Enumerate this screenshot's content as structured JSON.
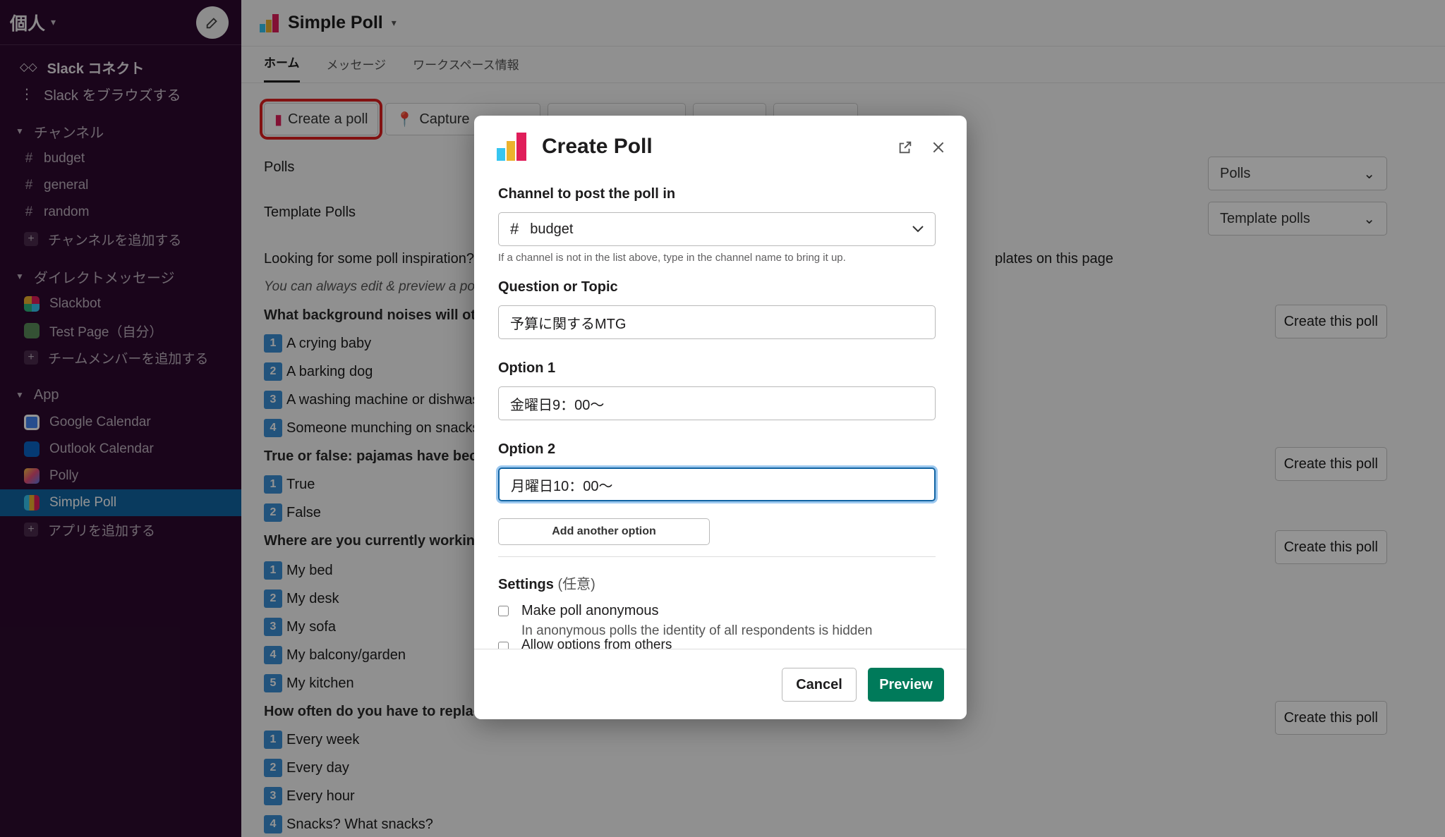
{
  "sidebar": {
    "workspace": "個人",
    "top_items": [
      "Slack コネクト",
      "Slack をブラウズする"
    ],
    "channels_header": "チャンネル",
    "channels": [
      "budget",
      "general",
      "random"
    ],
    "add_channel": "チャンネルを追加する",
    "dm_header": "ダイレクトメッセージ",
    "dms": [
      "Slackbot",
      "Test Page（自分）"
    ],
    "add_member": "チームメンバーを追加する",
    "app_header": "App",
    "apps": [
      "Google Calendar",
      "Outlook Calendar",
      "Polly",
      "Simple Poll"
    ],
    "add_app": "アプリを追加する"
  },
  "main": {
    "title": "Simple Poll",
    "tabs": [
      "ホーム",
      "メッセージ",
      "ワークスペース情報"
    ],
    "buttons": [
      "Create a poll",
      "Capture"
    ],
    "polls_label": "Polls",
    "polls_select": "Polls",
    "template_label": "Template Polls",
    "template_select": "Template polls",
    "inspiration": "Looking for some poll inspiration?",
    "inspiration_tail": "plates on this page",
    "edit_hint": "You can always edit & preview a poll",
    "create_this_poll": "Create this poll",
    "q1": "What background noises will othe",
    "q1_opts": [
      "A crying baby",
      "A barking dog",
      "A washing machine or dishwas",
      "Someone munching on snacks"
    ],
    "q2": "True or false: pajamas have becom",
    "q2_opts": [
      "True",
      "False"
    ],
    "q3": "Where are you currently working",
    "q3_opts": [
      "My bed",
      "My desk",
      "My sofa",
      "My balcony/garden",
      "My kitchen"
    ],
    "q4": "How often do you have to replace",
    "q4_opts": [
      "Every week",
      "Every day",
      "Every hour",
      "Snacks? What snacks?"
    ]
  },
  "modal": {
    "title": "Create Poll",
    "channel_label": "Channel to post the poll in",
    "channel_value": "budget",
    "channel_hint": "If a channel is not in the list above, type in the channel name to bring it up.",
    "question_label": "Question or Topic",
    "question_value": "予算に関するMTG",
    "option1_label": "Option 1",
    "option1_value": "金曜日9：00〜",
    "option2_label": "Option 2",
    "option2_value": "月曜日10：00〜",
    "add_option": "Add another option",
    "settings_label": "Settings",
    "settings_optional": "(任意)",
    "anon_label": "Make poll anonymous",
    "anon_desc": "In anonymous polls the identity of all respondents is hidden",
    "allow_label": "Allow options from others",
    "cancel": "Cancel",
    "preview": "Preview"
  },
  "colors": {
    "sidebar": "#2d0a2f",
    "active": "#1164a3",
    "preview": "#007a5a",
    "highlight": "#e01e1e"
  }
}
